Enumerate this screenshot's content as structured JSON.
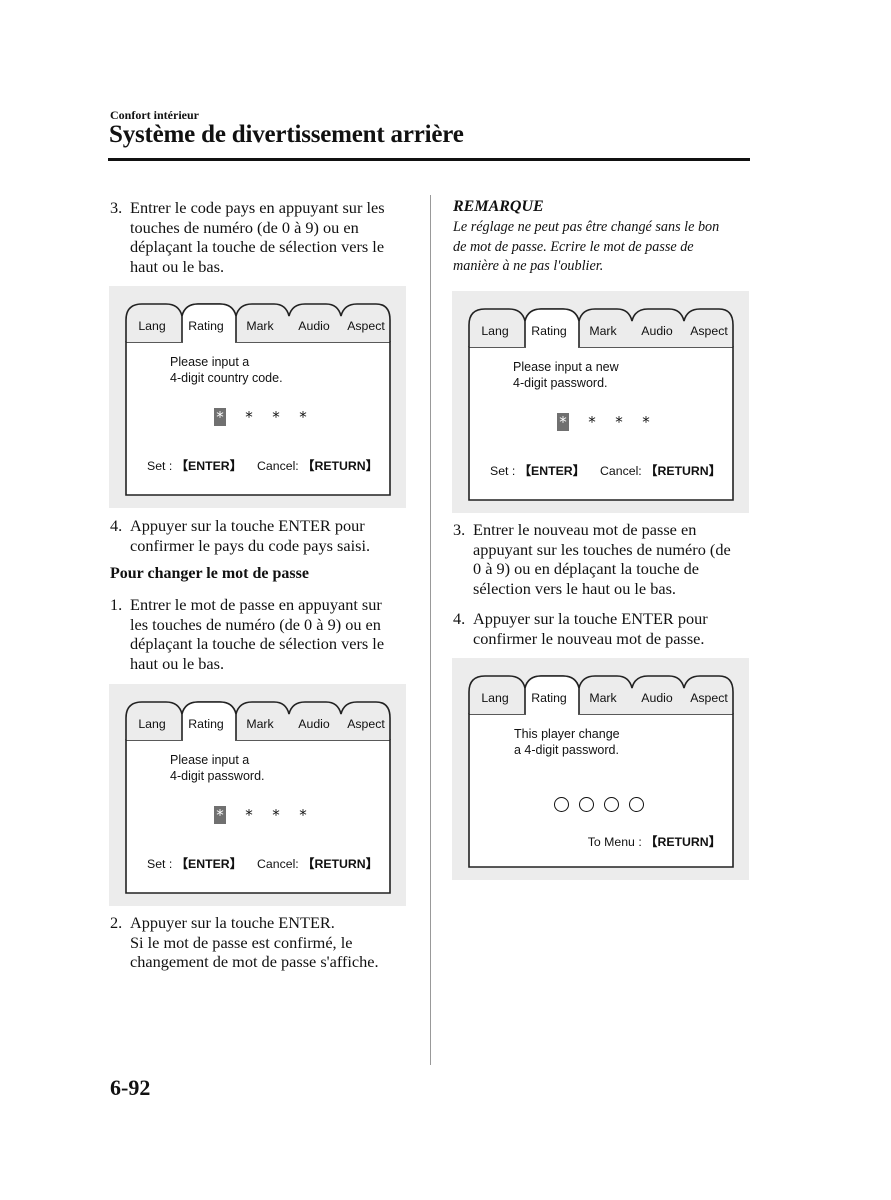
{
  "header": {
    "section": "Confort intérieur",
    "title": "Système de divertissement arrière"
  },
  "left_column": {
    "step3": {
      "num": "3.",
      "text": "Entrer le code pays en appuyant sur les\ntouches de numéro (de 0 à 9) ou en\ndéplaçant la touche de sélection vers le\nhaut ou le bas."
    },
    "step4": {
      "num": "4.",
      "text": "Appuyer sur la touche ENTER pour\nconfirmer le pays du code pays saisi."
    },
    "subheading": "Pour changer le mot de passe",
    "step1": {
      "num": "1.",
      "text": "Entrer le mot de passe en appuyant sur\nles touches de numéro (de 0 à 9) ou en\ndéplaçant la touche de sélection vers le\nhaut ou le bas."
    },
    "step2": {
      "num": "2.",
      "text": "Appuyer sur la touche ENTER.\nSi le mot de passe est confirmé, le\nchangement de mot de passe s'affiche."
    }
  },
  "right_column": {
    "remark_title": "REMARQUE",
    "remark_body": "Le réglage ne peut pas être changé sans le bon\nde mot de passe. Ecrire le mot de passe de\nmanière à ne pas l'oublier.",
    "step3": {
      "num": "3.",
      "text": "Entrer le nouveau mot de passe en\nappuyant sur les touches de numéro (de\n0 à 9) ou en déplaçant la touche de\nsélection vers le haut ou le bas."
    },
    "step4": {
      "num": "4.",
      "text": "Appuyer sur la touche ENTER pour\nconfirmer le nouveau mot de passe."
    }
  },
  "screen_tabs": [
    "Lang",
    "Rating",
    "Mark",
    "Audio",
    "Aspect"
  ],
  "active_tab": "Rating",
  "screens": {
    "country_code": {
      "message": "Please input a\n4-digit country code.",
      "digits": [
        "*",
        "*",
        "*",
        "*"
      ],
      "set_label": "Set : ",
      "set_key": "【ENTER】",
      "cancel_label": "Cancel: ",
      "cancel_key": "【RETURN】"
    },
    "password": {
      "message": "Please input a\n4-digit password.",
      "digits": [
        "*",
        "*",
        "*",
        "*"
      ],
      "set_label": "Set : ",
      "set_key": "【ENTER】",
      "cancel_label": "Cancel: ",
      "cancel_key": "【RETURN】"
    },
    "new_password": {
      "message": "Please input a new\n4-digit password.",
      "digits": [
        "*",
        "*",
        "*",
        "*"
      ],
      "set_label": "Set : ",
      "set_key": "【ENTER】",
      "cancel_label": "Cancel: ",
      "cancel_key": "【RETURN】"
    },
    "changed": {
      "message": "This player change\na 4-digit password.",
      "menu_label": "To Menu : ",
      "menu_key": "【RETURN】"
    }
  },
  "page_number": "6-92"
}
